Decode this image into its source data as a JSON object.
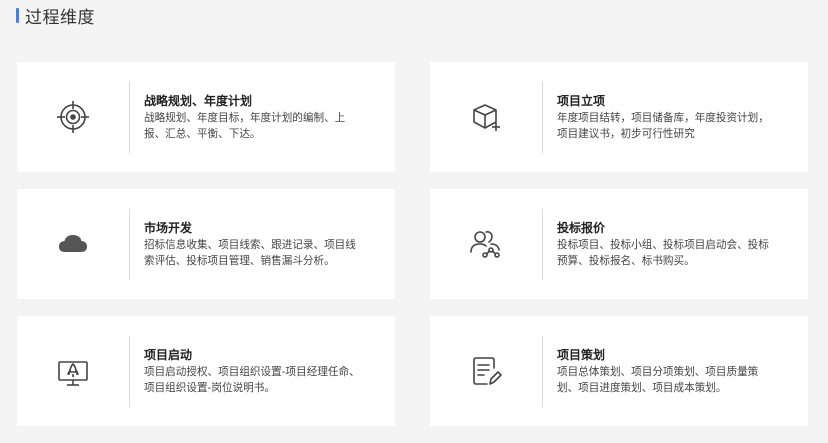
{
  "section": {
    "title": "过程维度",
    "accent_color": "#3b82f6"
  },
  "cards": [
    {
      "title": "战略规划、年度计划",
      "desc": "战略规划、年度目标，年度计划的编制、上报、汇总、平衡、下达。",
      "icon": "target-icon"
    },
    {
      "title": "项目立项",
      "desc": "年度项目结转，项目储备库，年度投资计划，项目建议书，初步可行性研究",
      "icon": "cube-plus-icon"
    },
    {
      "title": "市场开发",
      "desc": "招标信息收集、项目线索、跟进记录、项目线索评估、投标项目管理、销售漏斗分析。",
      "icon": "cloud-icon"
    },
    {
      "title": "投标报价",
      "desc": "投标项目、投标小组、投标项目启动会、投标预算、投标报名、标书购买。",
      "icon": "team-share-icon"
    },
    {
      "title": "项目启动",
      "desc": "项目启动授权、项目组织设置-项目经理任命、项目组织设置-岗位说明书。",
      "icon": "monitor-rocket-icon"
    },
    {
      "title": "项目策划",
      "desc": "项目总体策划、项目分项策划、项目质量策划、项目进度策划、项目成本策划。",
      "icon": "document-edit-icon"
    }
  ]
}
